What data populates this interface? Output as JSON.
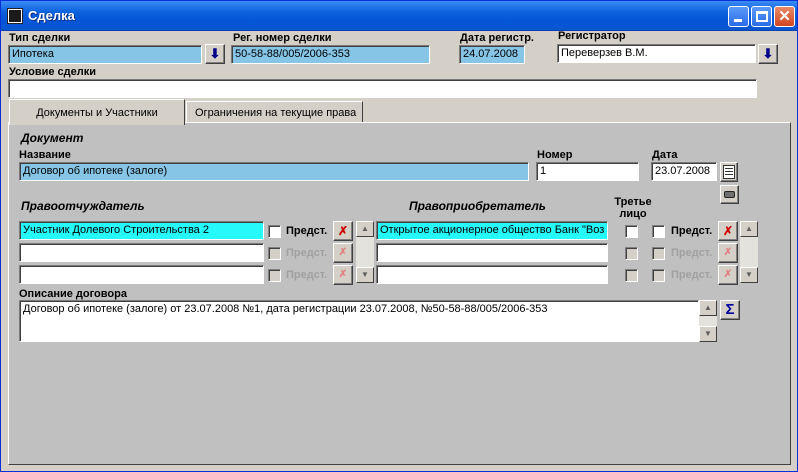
{
  "window": {
    "title": "Сделка"
  },
  "header": {
    "deal_type_label": "Тип сделки",
    "deal_type_value": "Ипотека",
    "reg_number_label": "Рег. номер сделки",
    "reg_number_value": "50-58-88/005/2006-353",
    "reg_date_label": "Дата регистр.",
    "reg_date_value": "24.07.2008",
    "registrar_label": "Регистратор",
    "registrar_value": "Переверзев В.М.",
    "condition_label": "Условие сделки",
    "condition_value": ""
  },
  "tabs": [
    {
      "label": "Документы и Участники",
      "active": true
    },
    {
      "label": "Ограничения на текущие права",
      "active": false
    }
  ],
  "document": {
    "section_label": "Документ",
    "name_label": "Название",
    "name_value": "Договор об ипотеке (залоге)",
    "number_label": "Номер",
    "number_value": "1",
    "date_label": "Дата",
    "date_value": "23.07.2008"
  },
  "participants": {
    "alienator_label": "Правоотчуждатель",
    "acquirer_label": "Правоприобретатель",
    "third_party_label": "Третье лицо",
    "representative_label": "Предст.",
    "alienators": [
      "Участник Долевого Строительства 2",
      "",
      ""
    ],
    "acquirers": [
      "Открытое акционерное общество Банк \"Воз",
      "",
      ""
    ]
  },
  "description": {
    "label": "Описание договора",
    "value": "Договор об ипотеке (залоге) от 23.07.2008 №1, дата регистрации 23.07.2008, №50-58-88/005/2006-353"
  },
  "icons": {
    "dropdown": "download-arrow-icon",
    "delete": "remove-icon",
    "sum": "sigma-icon",
    "calendar": "calendar-icon",
    "print": "stamp-icon"
  }
}
